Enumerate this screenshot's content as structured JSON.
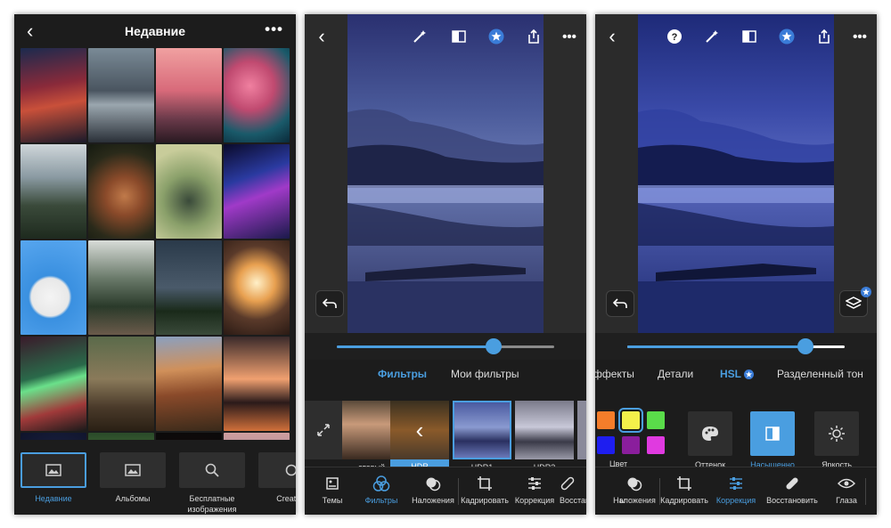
{
  "screen1": {
    "title": "Недавние",
    "bottom_items": [
      {
        "label": "Недавние",
        "icon": "image-icon",
        "active": true
      },
      {
        "label": "Альбомы",
        "icon": "album-icon",
        "active": false
      },
      {
        "label": "Бесплатные изображения",
        "icon": "search-icon",
        "active": false
      },
      {
        "label": "Creative",
        "icon": "creative-cloud-icon",
        "active": false
      }
    ]
  },
  "screen2": {
    "tabs": [
      "Фильтры",
      "Мои фильтры"
    ],
    "active_tab": "Фильтры",
    "filters": [
      "атовый",
      "HDR",
      "HDR1",
      "HDR3"
    ],
    "selected_filter": "HDR",
    "slider_value": 0.72,
    "nav": [
      "Темы",
      "Фильтры",
      "Наложения",
      "Кадрировать",
      "Коррекция",
      "Восстан"
    ],
    "active_nav": "Фильтры"
  },
  "screen3": {
    "tabs": [
      "ффекты",
      "Детали",
      "HSL",
      "Разделенный тон"
    ],
    "active_tab": "HSL",
    "color_label": "Цвет",
    "swatch_colors": [
      "#f47d2a",
      "#f4f04a",
      "#5adc4a",
      "#1e1ef0",
      "#8a1e9c",
      "#e03ae0"
    ],
    "selected_swatch": "#f4f04a",
    "controls": [
      {
        "label": "Оттенок",
        "icon": "palette-icon",
        "active": false
      },
      {
        "label": "Насыщенность",
        "icon": "saturation-icon",
        "active": true
      },
      {
        "label": "Яркость",
        "icon": "brightness-icon",
        "active": false
      }
    ],
    "slider_value": 0.82,
    "nav": [
      "ы",
      "Наложения",
      "Кадрировать",
      "Коррекция",
      "Восстановить",
      "Глаза"
    ],
    "active_nav": "Коррекция"
  },
  "colors": {
    "accent": "#4a9ee0",
    "background": "#1c1c1c"
  }
}
